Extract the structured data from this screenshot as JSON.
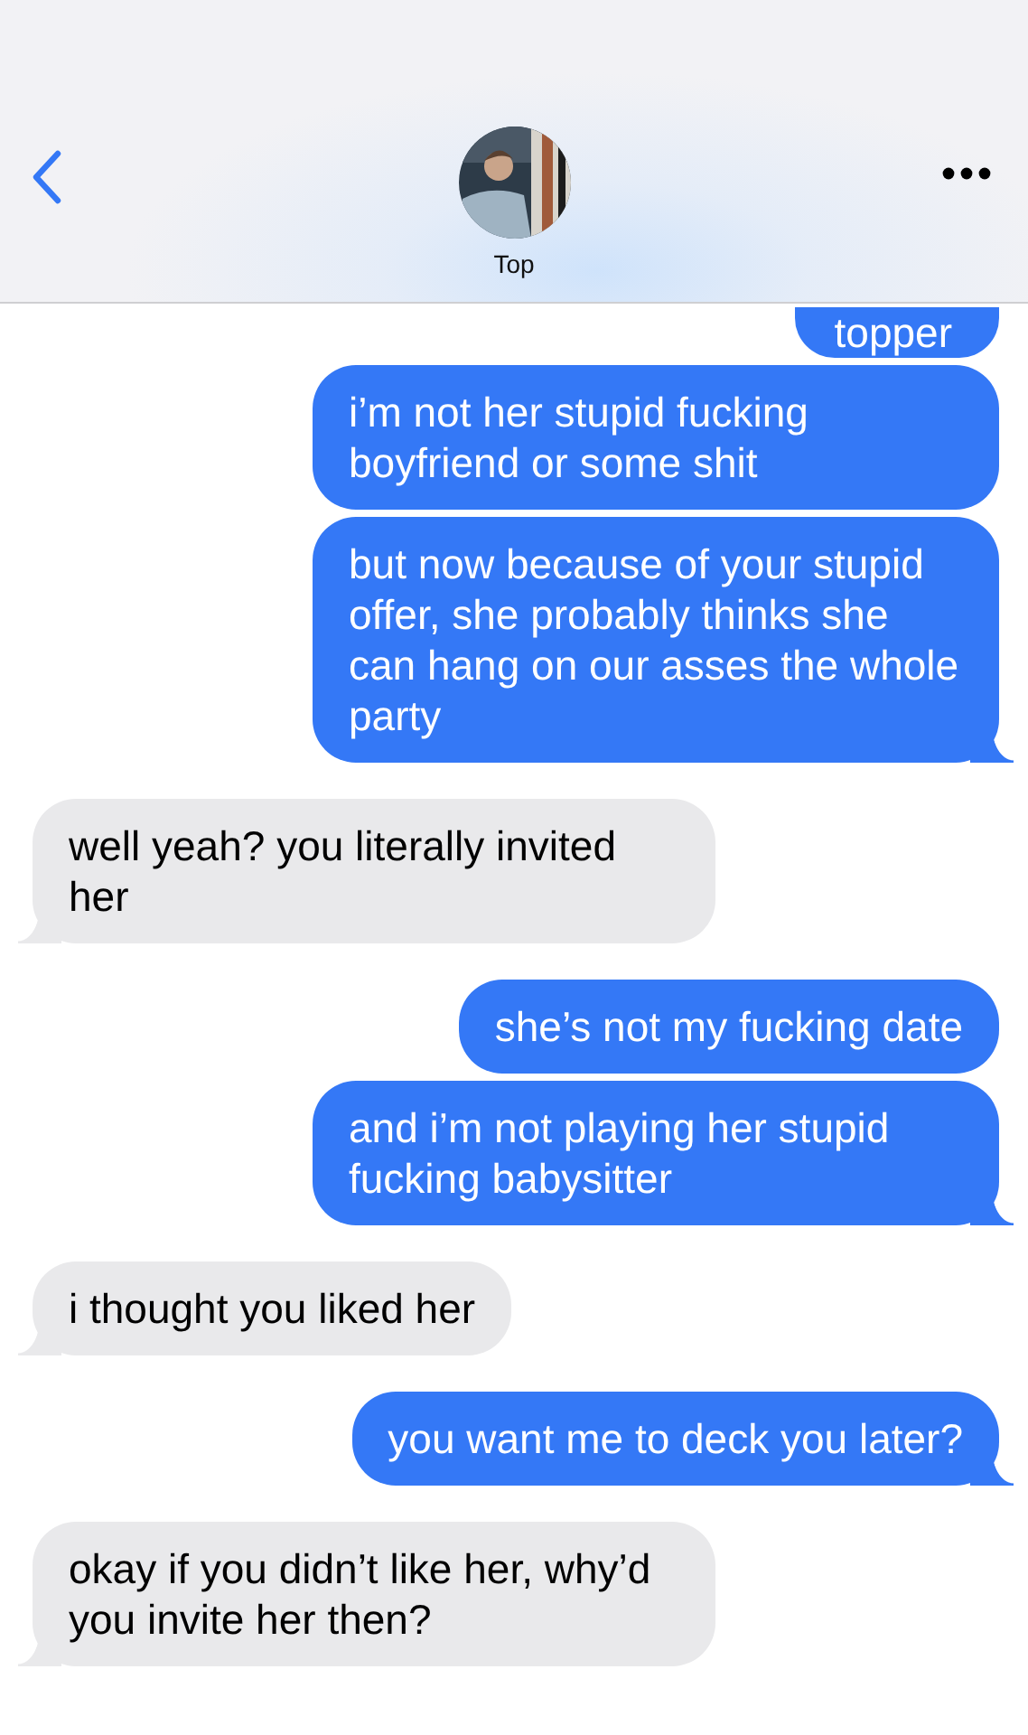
{
  "header": {
    "name": "Top"
  },
  "messages": [
    {
      "kind": "sent",
      "text": "topper",
      "tail": false,
      "cut": true
    },
    {
      "kind": "sent",
      "text": "i’m not her stupid fucking boyfriend or some shit",
      "tail": false,
      "cut": false
    },
    {
      "kind": "sent",
      "text": "but now because of your stupid offer, she probably thinks she can hang on our asses the whole party",
      "tail": true,
      "cut": false
    },
    {
      "kind": "received",
      "text": "well yeah? you literally invited her",
      "tail": true,
      "cut": false
    },
    {
      "kind": "sent",
      "text": "she’s not my fucking date",
      "tail": false,
      "cut": false
    },
    {
      "kind": "sent",
      "text": "and i’m not playing her stupid fucking babysitter",
      "tail": true,
      "cut": false
    },
    {
      "kind": "received",
      "text": "i thought you liked her",
      "tail": true,
      "cut": false
    },
    {
      "kind": "sent",
      "text": "you want me to deck you later?",
      "tail": true,
      "cut": false
    },
    {
      "kind": "received",
      "text": "okay if you didn’t like her, why’d you invite her then?",
      "tail": true,
      "cut": false
    }
  ]
}
